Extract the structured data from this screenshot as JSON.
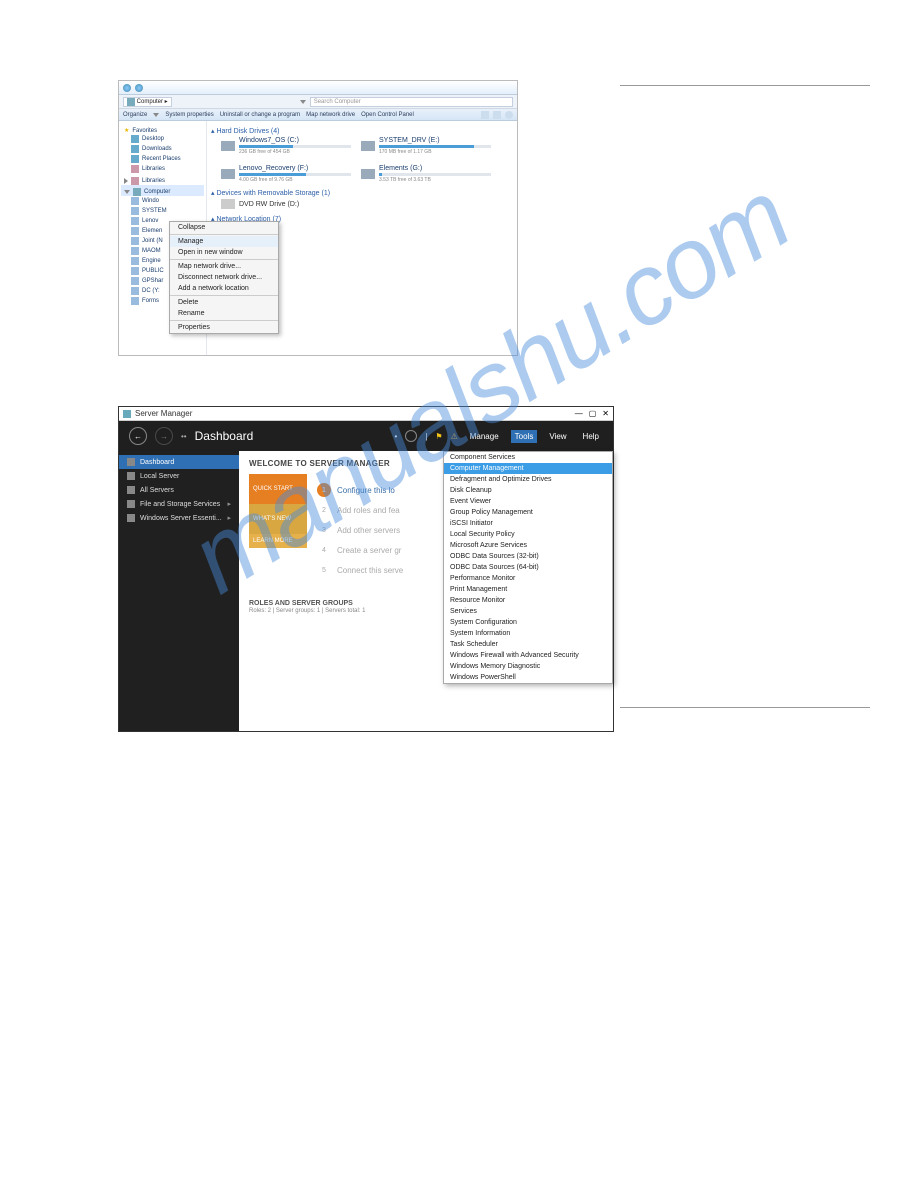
{
  "watermark": "manualshu.com",
  "screenshot1": {
    "window": {
      "breadcrumb": "Computer",
      "search_placeholder": "Search Computer"
    },
    "toolbar": {
      "organize": "Organize",
      "system_properties": "System properties",
      "uninstall": "Uninstall or change a program",
      "map_drive": "Map network drive",
      "control_panel": "Open Control Panel"
    },
    "sidebar": {
      "favorites_label": "Favorites",
      "favorites": [
        {
          "label": "Desktop"
        },
        {
          "label": "Downloads"
        },
        {
          "label": "Recent Places"
        },
        {
          "label": "Libraries"
        }
      ],
      "libraries_label": "Libraries",
      "computer_label": "Computer",
      "computer_items": [
        {
          "label": "Windo"
        },
        {
          "label": "SYSTEM"
        },
        {
          "label": "Lenov"
        },
        {
          "label": "Elemen"
        },
        {
          "label": "Joint (N"
        },
        {
          "label": "MAOM"
        },
        {
          "label": "Engine"
        },
        {
          "label": "PUBLIC"
        },
        {
          "label": "GPShar"
        },
        {
          "label": "DC (Y:"
        },
        {
          "label": "Forms"
        }
      ]
    },
    "main": {
      "groups": {
        "hdd": "Hard Disk Drives (4)",
        "removable": "Devices with Removable Storage (1)",
        "network": "Network Location (7)"
      },
      "drives": [
        {
          "name": "Windows7_OS (C:)",
          "free": "236 GB free of 454 GB",
          "fill_pct": 48
        },
        {
          "name": "SYSTEM_DRV (E:)",
          "free": "170 MB free of 1.17 GB",
          "fill_pct": 85
        },
        {
          "name": "Lenovo_Recovery (F:)",
          "free": "4.00 GB free of 9.76 GB",
          "fill_pct": 60
        },
        {
          "name": "Elements (G:)",
          "free": "3.53 TB free of 3.63 TB",
          "fill_pct": 3
        }
      ],
      "dvd": "DVD RW Drive (D:)"
    },
    "context_menu": {
      "items": [
        "Collapse",
        "Manage",
        "Open in new window",
        "Map network drive...",
        "Disconnect network drive...",
        "Add a network location",
        "Delete",
        "Rename",
        "Properties"
      ],
      "selected": "Manage"
    }
  },
  "screenshot2": {
    "window_title": "Server Manager",
    "header": {
      "dashboard": "Dashboard",
      "menu": {
        "manage": "Manage",
        "tools": "Tools",
        "view": "View",
        "help": "Help"
      }
    },
    "nav": [
      {
        "label": "Dashboard",
        "selected": true
      },
      {
        "label": "Local Server"
      },
      {
        "label": "All Servers"
      },
      {
        "label": "File and Storage Services"
      },
      {
        "label": "Windows Server Essenti..."
      }
    ],
    "main": {
      "welcome": "WELCOME TO SERVER MANAGER",
      "tiles": {
        "quick_start": "QUICK START",
        "whats_new": "WHAT'S NEW",
        "learn_more": "LEARN MORE"
      },
      "steps": [
        {
          "n": "1",
          "label": "Configure this lo"
        },
        {
          "n": "2",
          "label": "Add roles and fea"
        },
        {
          "n": "3",
          "label": "Add other servers"
        },
        {
          "n": "4",
          "label": "Create a server gr"
        },
        {
          "n": "5",
          "label": "Connect this serve"
        }
      ],
      "roles_heading": "ROLES AND SERVER GROUPS",
      "roles_sub": "Roles: 2  |  Server groups: 1  |  Servers total: 1"
    },
    "tools_menu": {
      "items": [
        "Component Services",
        "Computer Management",
        "Defragment and Optimize Drives",
        "Disk Cleanup",
        "Event Viewer",
        "Group Policy Management",
        "iSCSI Initiator",
        "Local Security Policy",
        "Microsoft Azure Services",
        "ODBC Data Sources (32-bit)",
        "ODBC Data Sources (64-bit)",
        "Performance Monitor",
        "Print Management",
        "Resource Monitor",
        "Services",
        "System Configuration",
        "System Information",
        "Task Scheduler",
        "Windows Firewall with Advanced Security",
        "Windows Memory Diagnostic",
        "Windows PowerShell"
      ],
      "selected": "Computer Management"
    }
  }
}
